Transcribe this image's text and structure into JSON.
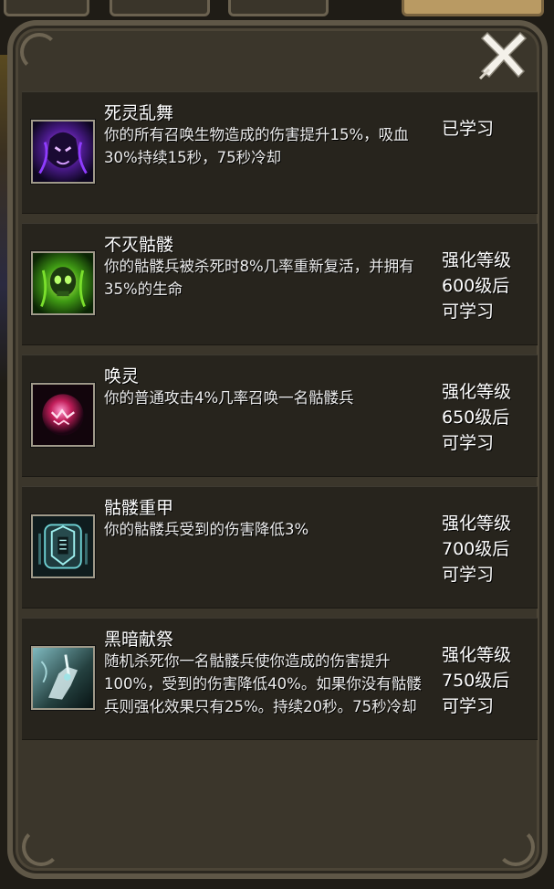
{
  "close_button": {
    "icon": "close-x-icon"
  },
  "skills": [
    {
      "name": "死灵乱舞",
      "icon": "shadow-demon-icon",
      "description": "你的所有召唤生物造成的伤害提升15%，吸血30%持续15秒，75秒冷却",
      "status": [
        "已学习"
      ]
    },
    {
      "name": "不灭骷髅",
      "icon": "green-skull-icon",
      "description": "你的骷髅兵被杀死时8%几率重新复活，并拥有35%的生命",
      "status": [
        "强化等级",
        "600级后",
        "可学习"
      ]
    },
    {
      "name": "唤灵",
      "icon": "spirit-orb-icon",
      "description": "你的普通攻击4%几率召唤一名骷髅兵",
      "status": [
        "强化等级",
        "650级后",
        "可学习"
      ]
    },
    {
      "name": "骷髅重甲",
      "icon": "skeleton-armor-icon",
      "description": "你的骷髅兵受到的伤害降低3%",
      "status": [
        "强化等级",
        "700级后",
        "可学习"
      ]
    },
    {
      "name": "黑暗献祭",
      "icon": "dark-sacrifice-icon",
      "description": "随机杀死你一名骷髅兵使你造成的伤害提升100%，受到的伤害降低40%。如果你没有骷髅兵则强化效果只有25%。持续20秒。75秒冷却",
      "status": [
        "强化等级",
        "750级后",
        "可学习"
      ]
    }
  ]
}
